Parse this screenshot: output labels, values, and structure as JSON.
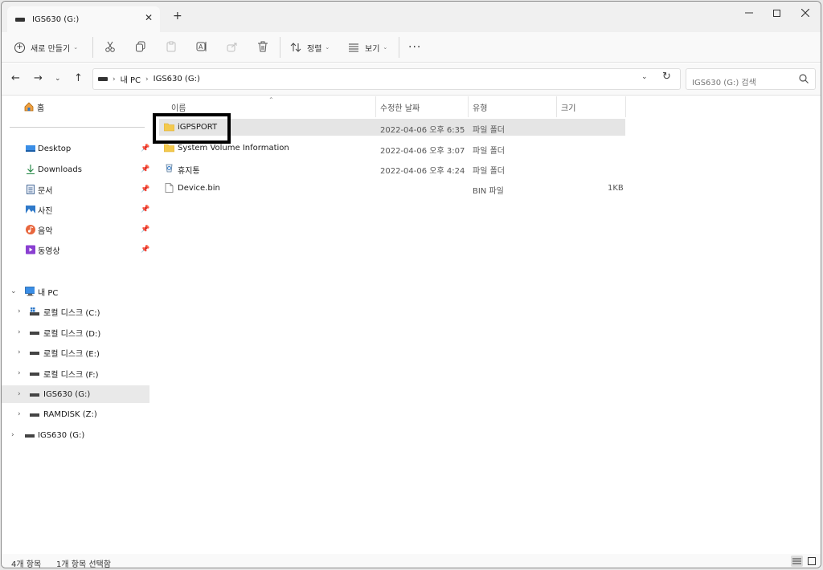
{
  "window": {
    "tab_title": "IGS630 (G:)",
    "tab_close": "✕",
    "new_tab": "+"
  },
  "toolbar": {
    "new_label": "새로 만들기",
    "sort_label": "정렬",
    "view_label": "보기",
    "more": "···"
  },
  "address": {
    "crumbs": [
      "내 PC",
      "IGS630 (G:)"
    ],
    "search_placeholder": "IGS630 (G:) 검색"
  },
  "sidebar": {
    "home": "홈",
    "quick_access": [
      {
        "label": "Desktop",
        "icon": "desktop-icon"
      },
      {
        "label": "Downloads",
        "icon": "download-icon"
      },
      {
        "label": "문서",
        "icon": "documents-icon"
      },
      {
        "label": "사진",
        "icon": "pictures-icon"
      },
      {
        "label": "음악",
        "icon": "music-icon"
      },
      {
        "label": "동영상",
        "icon": "videos-icon"
      }
    ],
    "this_pc": "내 PC",
    "drives": [
      {
        "label": "로컬 디스크 (C:)"
      },
      {
        "label": "로컬 디스크 (D:)"
      },
      {
        "label": "로컬 디스크 (E:)"
      },
      {
        "label": "로컬 디스크 (F:)"
      },
      {
        "label": "IGS630 (G:)",
        "selected": true
      },
      {
        "label": "RAMDISK (Z:)"
      }
    ],
    "external_drive": "IGS630 (G:)"
  },
  "columns": {
    "name": "이름",
    "date": "수정한 날짜",
    "type": "유형",
    "size": "크기"
  },
  "files": [
    {
      "name": "iGPSPORT",
      "date": "2022-04-06 오후 6:35",
      "type": "파일 폴더",
      "size": "",
      "icon": "folder-icon",
      "selected": true
    },
    {
      "name": "System Volume Information",
      "date": "2022-04-06 오후 3:07",
      "type": "파일 폴더",
      "size": "",
      "icon": "folder-icon"
    },
    {
      "name": "휴지통",
      "date": "2022-04-06 오후 4:24",
      "type": "파일 폴더",
      "size": "",
      "icon": "recycle-bin-icon"
    },
    {
      "name": "Device.bin",
      "date": "",
      "type": "BIN 파일",
      "size": "1KB",
      "icon": "file-icon"
    }
  ],
  "status": {
    "item_count": "4개 항목",
    "selected_count": "1개 항목 선택함"
  },
  "colors": {
    "folder": "#f3c94e",
    "selection": "#e5e5e5",
    "accent": "#0067c0"
  }
}
